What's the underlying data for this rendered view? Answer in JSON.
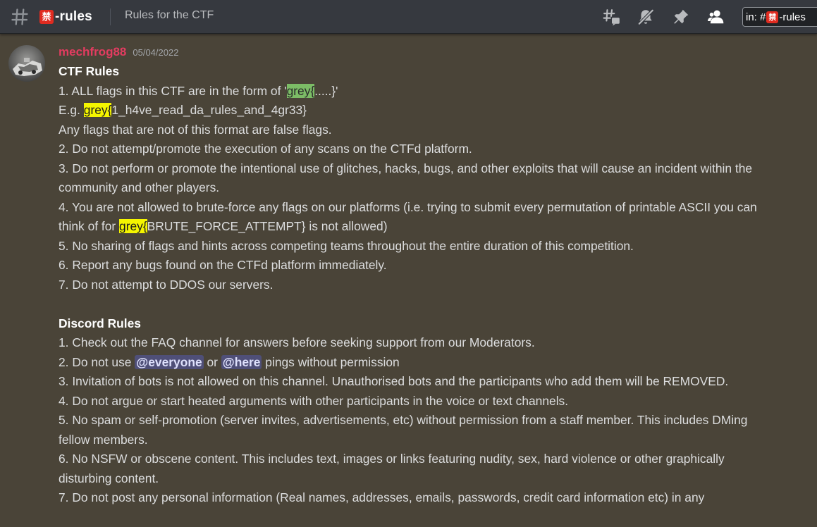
{
  "header": {
    "channel_name": "-rules",
    "channel_badge": "禁",
    "topic": "Rules for the CTF",
    "search": {
      "prefix": "in: #",
      "badge": "禁",
      "suffix": "-rules"
    },
    "icons": [
      "hash-icon",
      "threads-icon",
      "mute-notifications-icon",
      "pin-icon",
      "member-list-icon"
    ]
  },
  "message": {
    "author": "mechfrog88",
    "timestamp": "05/04/2022",
    "author_color": "#e33c60",
    "ctf": {
      "heading": "CTF Rules",
      "line1": {
        "pre": "1. ALL flags in this CTF are in the form of '",
        "hl": "grey{",
        "post": ".....}'"
      },
      "line2": {
        "pre": "E.g. ",
        "hl": "grey{",
        "post": "1_h4ve_read_da_rules_and_4gr33}"
      },
      "line3": "Any flags that are not of this format are false flags.",
      "line4": "2. Do not attempt/promote the execution of any scans on the CTFd platform.",
      "line5": "3. Do not perform or promote the intentional use of glitches, hacks, bugs, and other exploits that will cause an incident within the community and other players.",
      "line6": {
        "pre": "4. You are not allowed to brute-force any flags on our platforms (i.e. trying to submit every permutation of printable ASCII you can think of for ",
        "hl": "grey{",
        "post": "BRUTE_FORCE_ATTEMPT} is not allowed)"
      },
      "line7": "5. No sharing of flags and hints across competing teams throughout the entire duration of this competition.",
      "line8": "6. Report any bugs found on the CTFd platform immediately.",
      "line9": "7. Do not attempt to DDOS our servers."
    },
    "discord": {
      "heading": "Discord Rules",
      "line1": "1. Check out the FAQ channel for answers before seeking support from our Moderators.",
      "line2": {
        "pre": "2. Do not use ",
        "mention1": "@everyone",
        "mid": " or ",
        "mention2": "@here",
        "post": " pings without permission"
      },
      "line3": "3. Invitation of bots is not allowed on this channel. Unauthorised bots and the participants who add them will be REMOVED.",
      "line4": "4. Do not argue or start heated arguments with other participants in the voice or text channels.",
      "line5": "5. No spam or self-promotion (server invites, advertisements, etc) without permission from a staff member. This includes DMing fellow members.",
      "line6": "6. No NSFW or obscene content. This includes text, images or links featuring nudity, sex, hard violence or other graphically disturbing content.",
      "line7": "7. Do not post any personal information (Real names, addresses, emails, passwords, credit card information etc) in any"
    }
  }
}
